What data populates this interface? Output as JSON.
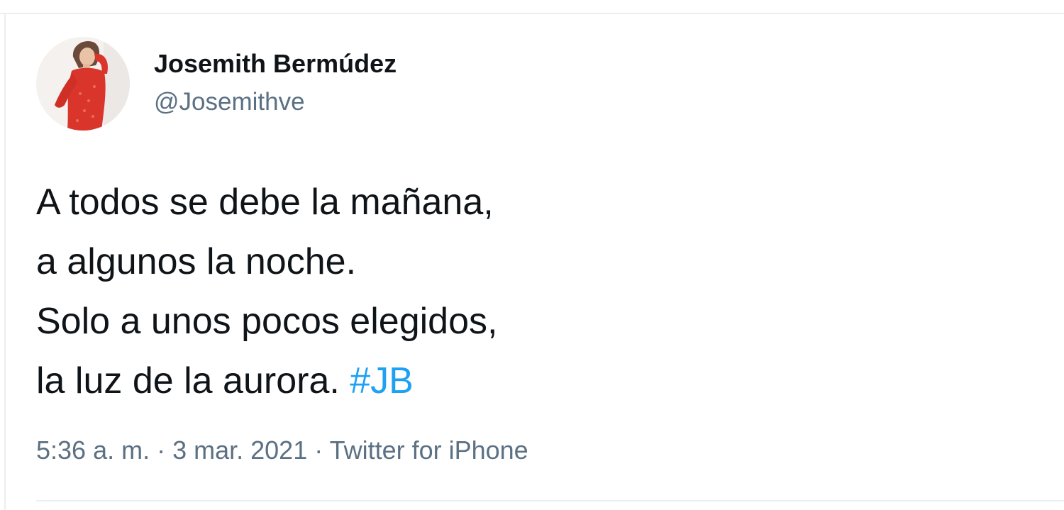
{
  "tweet": {
    "author_name": "Josemith Bermúdez",
    "handle": "@Josemithve",
    "lines": [
      "A todos se debe la mañana,",
      "a algunos la noche.",
      "Solo a unos pocos elegidos,",
      "la luz de la aurora."
    ],
    "hashtag": "#JB",
    "time": "5:36 a. m.",
    "separator": " · ",
    "date": "3 mar. 2021",
    "source": "Twitter for iPhone"
  },
  "colors": {
    "text": "#0f1419",
    "secondary": "#5b7083",
    "link": "#1da1f2",
    "border": "#ebeef0",
    "avatar_dress": "#d9352b"
  }
}
